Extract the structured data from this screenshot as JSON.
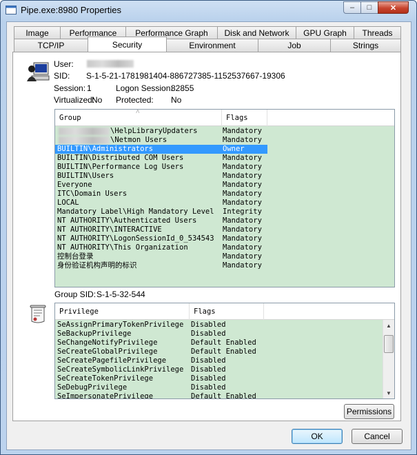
{
  "window": {
    "title": "Pipe.exe:8980 Properties",
    "caption_buttons": {
      "minimize": "–",
      "maximize": "□",
      "close": "✕"
    }
  },
  "tabs": {
    "row1": [
      "Image",
      "Performance",
      "Performance Graph",
      "Disk and Network",
      "GPU Graph",
      "Threads"
    ],
    "row2": [
      "TCP/IP",
      "Security",
      "Environment",
      "Job",
      "Strings"
    ],
    "active": "Security"
  },
  "security": {
    "user_label": "User:",
    "user_value": "",
    "sid_label": "SID:",
    "sid_value": "S-1-5-21-1781981404-886727385-1152537667-19306",
    "session_label": "Session:",
    "session_value": "1",
    "logon_session_label": "Logon Session:",
    "logon_session_value": "82855",
    "virtualized_label": "Virtualized:",
    "virtualized_value": "No",
    "protected_label": "Protected:",
    "protected_value": "No",
    "group_sid_label": "Group SID:",
    "group_sid_value": "S-1-5-32-544"
  },
  "groups": {
    "columns": [
      "Group",
      "Flags"
    ],
    "sort_indicator": "˄",
    "rows": [
      {
        "group": "\\HelpLibraryUpdaters",
        "flags": "Mandatory",
        "redacted_prefix": true
      },
      {
        "group": "\\Netmon Users",
        "flags": "Mandatory",
        "redacted_prefix": true
      },
      {
        "group": "BUILTIN\\Administrators",
        "flags": "Owner",
        "selected": true
      },
      {
        "group": "BUILTIN\\Distributed COM Users",
        "flags": "Mandatory"
      },
      {
        "group": "BUILTIN\\Performance Log Users",
        "flags": "Mandatory"
      },
      {
        "group": "BUILTIN\\Users",
        "flags": "Mandatory"
      },
      {
        "group": "Everyone",
        "flags": "Mandatory"
      },
      {
        "group": "ITC\\Domain Users",
        "flags": "Mandatory"
      },
      {
        "group": "LOCAL",
        "flags": "Mandatory"
      },
      {
        "group": "Mandatory Label\\High Mandatory Level",
        "flags": "Integrity"
      },
      {
        "group": "NT AUTHORITY\\Authenticated Users",
        "flags": "Mandatory"
      },
      {
        "group": "NT AUTHORITY\\INTERACTIVE",
        "flags": "Mandatory"
      },
      {
        "group": "NT AUTHORITY\\LogonSessionId_0_534543",
        "flags": "Mandatory"
      },
      {
        "group": "NT AUTHORITY\\This Organization",
        "flags": "Mandatory"
      },
      {
        "group": "控制台登录",
        "flags": "Mandatory"
      },
      {
        "group": "身份验证机构声明的标识",
        "flags": "Mandatory"
      }
    ]
  },
  "privileges": {
    "columns": [
      "Privilege",
      "Flags"
    ],
    "rows": [
      {
        "privilege": "SeAssignPrimaryTokenPrivilege",
        "flags": "Disabled"
      },
      {
        "privilege": "SeBackupPrivilege",
        "flags": "Disabled"
      },
      {
        "privilege": "SeChangeNotifyPrivilege",
        "flags": "Default Enabled"
      },
      {
        "privilege": "SeCreateGlobalPrivilege",
        "flags": "Default Enabled"
      },
      {
        "privilege": "SeCreatePagefilePrivilege",
        "flags": "Disabled"
      },
      {
        "privilege": "SeCreateSymbolicLinkPrivilege",
        "flags": "Disabled"
      },
      {
        "privilege": "SeCreateTokenPrivilege",
        "flags": "Disabled"
      },
      {
        "privilege": "SeDebugPrivilege",
        "flags": "Disabled"
      },
      {
        "privilege": "SeImpersonatePrivilege",
        "flags": "Default Enabled"
      }
    ]
  },
  "buttons": {
    "permissions": "Permissions",
    "ok": "OK",
    "cancel": "Cancel"
  },
  "icons": {
    "app": "app-window-icon",
    "user": "computer-user-icon",
    "privileges": "certificate-scroll-icon"
  },
  "colors": {
    "list_background": "#cfe8d2",
    "selection": "#3399ff"
  }
}
